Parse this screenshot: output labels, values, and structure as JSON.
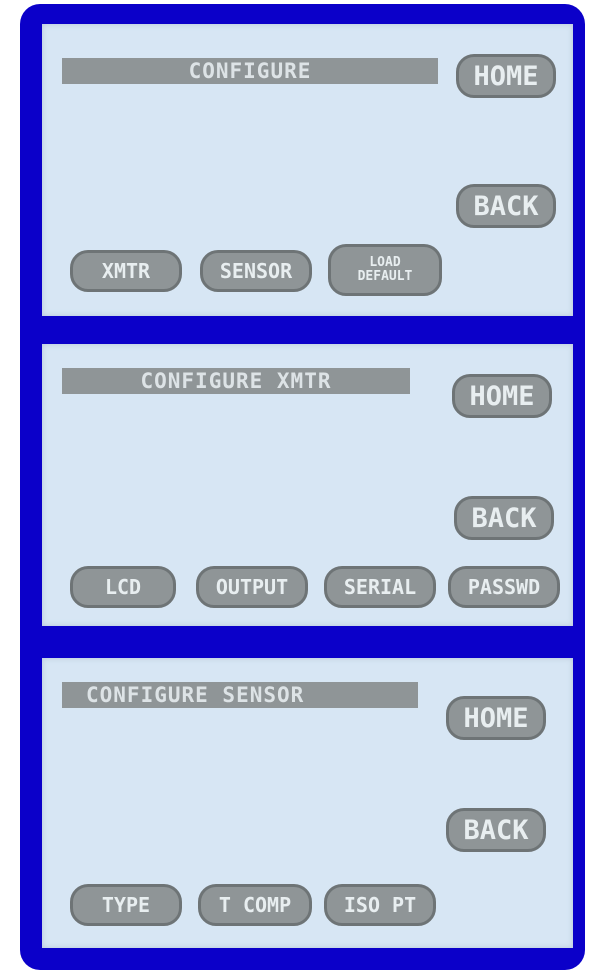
{
  "screens": [
    {
      "title": "CONFIGURE",
      "home_label": "HOME",
      "back_label": "BACK",
      "buttons": [
        {
          "label": "XMTR"
        },
        {
          "label": "SENSOR"
        },
        {
          "label_line1": "LOAD",
          "label_line2": "DEFAULT"
        }
      ]
    },
    {
      "title": "CONFIGURE XMTR",
      "home_label": "HOME",
      "back_label": "BACK",
      "buttons": [
        {
          "label": "LCD"
        },
        {
          "label": "OUTPUT"
        },
        {
          "label": "SERIAL"
        },
        {
          "label": "PASSWD"
        }
      ]
    },
    {
      "title": "CONFIGURE SENSOR",
      "home_label": "HOME",
      "back_label": "BACK",
      "buttons": [
        {
          "label": "TYPE"
        },
        {
          "label": "T COMP"
        },
        {
          "label": "ISO PT"
        }
      ]
    }
  ],
  "colors": {
    "frame": "#0b00c9",
    "screen": "#d7e6f4",
    "element": "#8f9597"
  }
}
